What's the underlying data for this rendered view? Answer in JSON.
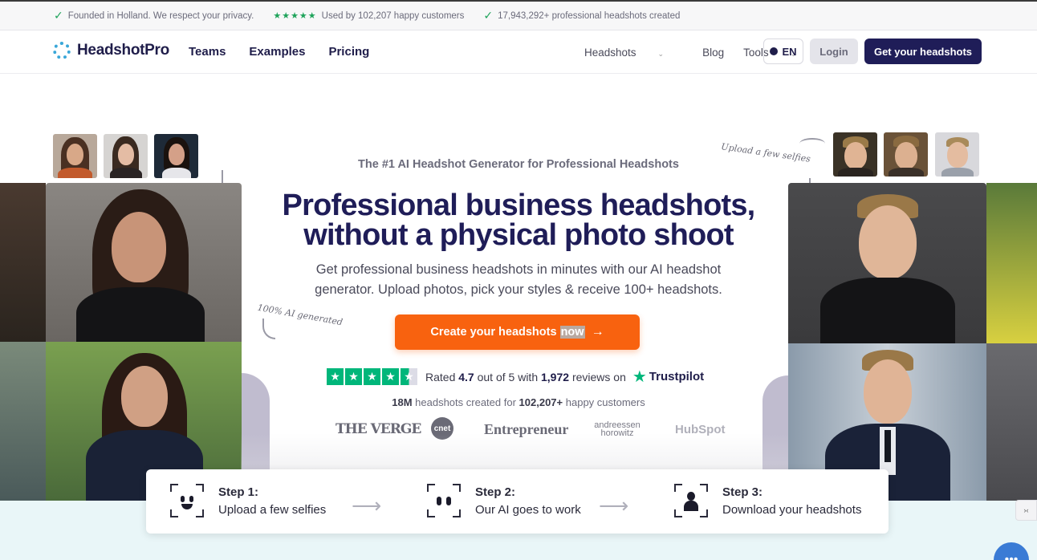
{
  "topbar": {
    "items": [
      {
        "icon": "check-icon",
        "text": "Founded in Holland. We respect your privacy."
      },
      {
        "icon": "five-stars-icon",
        "text": "Used by 102,207 happy customers"
      },
      {
        "icon": "check-icon",
        "text": "17,943,292+ professional headshots created"
      }
    ]
  },
  "nav": {
    "brand": "HeadshotPro",
    "links": [
      "Teams",
      "Examples",
      "Pricing"
    ],
    "right_links": [
      "Headshots",
      "Blog",
      "Tools"
    ],
    "lang": "EN",
    "login": "Login",
    "cta": "Get your headshots"
  },
  "hero": {
    "eyebrow": "The #1 AI Headshot Generator for Professional Headshots",
    "title_line1": "Professional business headshots,",
    "title_line2": "without a physical photo shoot",
    "desc_line1": "Get professional business headshots in minutes with our AI headshot",
    "desc_line2": "generator. Upload photos, pick your styles & receive 100+ headshots.",
    "cta_text": "Create your headshots",
    "cta_highlight": "now",
    "note_left": "100% AI generated",
    "note_right": "Upload a few selfies"
  },
  "rating": {
    "prefix": "Rated",
    "score": "4.7",
    "mid": "out of 5 with",
    "reviews": "1,972",
    "suffix": "reviews on",
    "platform": "Trustpilot",
    "stars": 4.5
  },
  "stats": {
    "headshots": "18M",
    "text_mid": "headshots created for",
    "customers": "102,207+",
    "text_end": "happy customers"
  },
  "press": [
    "THE VERGE",
    "cnet",
    "Entrepreneur",
    "andreessen horowitz",
    "HubSpot"
  ],
  "steps": [
    {
      "title": "Step 1:",
      "desc": "Upload a few selfies",
      "icon": "selfie-face-icon"
    },
    {
      "title": "Step 2:",
      "desc": "Our AI goes to work",
      "icon": "ai-eyes-icon"
    },
    {
      "title": "Step 3:",
      "desc": "Download your headshots",
      "icon": "person-silhouette-icon"
    }
  ],
  "colors": {
    "navy": "#1f1d58",
    "orange": "#f8620f",
    "trustpilot_green": "#00b67a",
    "check_green": "#1ea35a"
  }
}
